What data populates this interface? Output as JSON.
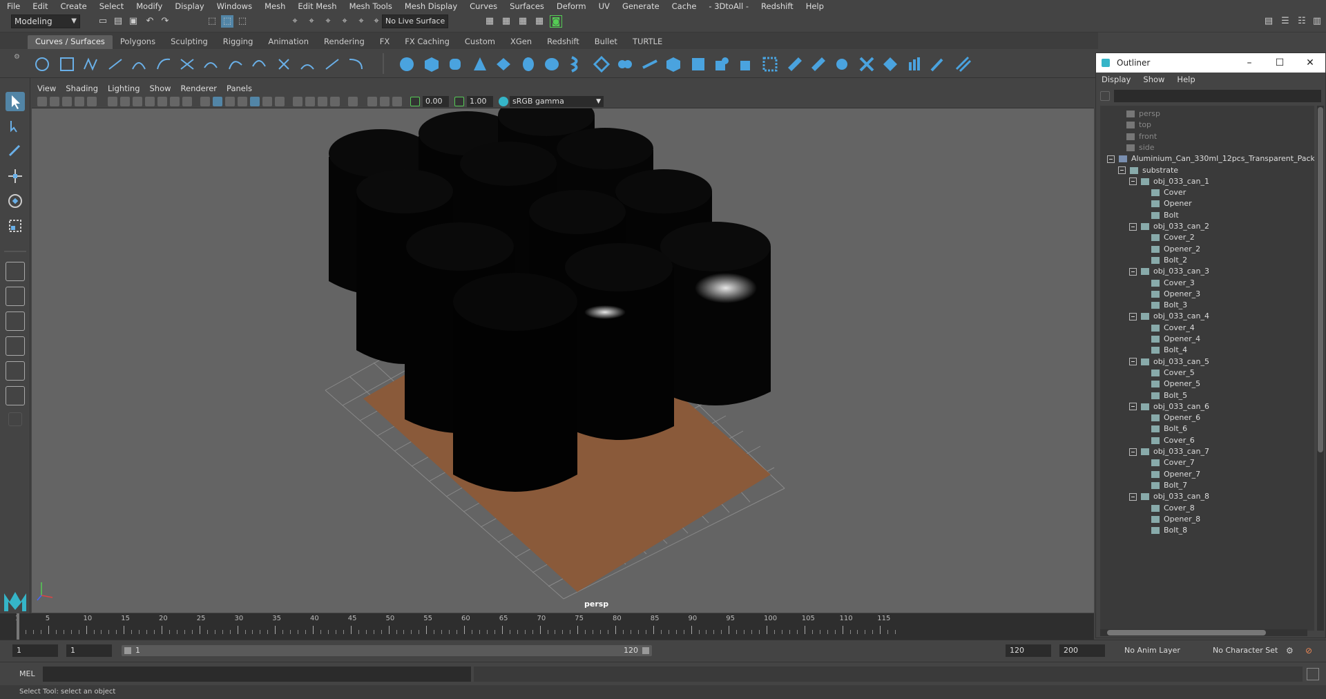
{
  "menubar": [
    "File",
    "Edit",
    "Create",
    "Select",
    "Modify",
    "Display",
    "Windows",
    "Mesh",
    "Edit Mesh",
    "Mesh Tools",
    "Mesh Display",
    "Curves",
    "Surfaces",
    "Deform",
    "UV",
    "Generate",
    "Cache",
    "- 3DtoAll -",
    "Redshift",
    "Help"
  ],
  "statusline": {
    "mode": "Modeling",
    "live_surface": "No Live Surface"
  },
  "shelf_tabs": [
    "Curves / Surfaces",
    "Polygons",
    "Sculpting",
    "Rigging",
    "Animation",
    "Rendering",
    "FX",
    "FX Caching",
    "Custom",
    "XGen",
    "Redshift",
    "Bullet",
    "TURTLE"
  ],
  "shelf_active": "Curves / Surfaces",
  "panel_menu": [
    "View",
    "Shading",
    "Lighting",
    "Show",
    "Renderer",
    "Panels"
  ],
  "panel_toolbar": {
    "exposure": "0.00",
    "gamma": "1.00",
    "colorspace": "sRGB gamma"
  },
  "viewport": {
    "camera": "persp"
  },
  "outliner": {
    "title": "Outliner",
    "menu": [
      "Display",
      "Show",
      "Help"
    ],
    "cameras": [
      "persp",
      "top",
      "front",
      "side"
    ],
    "root": "Aluminium_Can_330ml_12pcs_Transparent_Pack",
    "group": "substrate",
    "cans": [
      {
        "name": "obj_033_can_1",
        "children": [
          "Cover",
          "Opener",
          "Bolt"
        ]
      },
      {
        "name": "obj_033_can_2",
        "children": [
          "Cover_2",
          "Opener_2",
          "Bolt_2"
        ]
      },
      {
        "name": "obj_033_can_3",
        "children": [
          "Cover_3",
          "Opener_3",
          "Bolt_3"
        ]
      },
      {
        "name": "obj_033_can_4",
        "children": [
          "Cover_4",
          "Opener_4",
          "Bolt_4"
        ]
      },
      {
        "name": "obj_033_can_5",
        "children": [
          "Cover_5",
          "Opener_5",
          "Bolt_5"
        ]
      },
      {
        "name": "obj_033_can_6",
        "children": [
          "Opener_6",
          "Bolt_6",
          "Cover_6"
        ]
      },
      {
        "name": "obj_033_can_7",
        "children": [
          "Cover_7",
          "Opener_7",
          "Bolt_7"
        ]
      },
      {
        "name": "obj_033_can_8",
        "children": [
          "Cover_8",
          "Opener_8",
          "Bolt_8"
        ]
      }
    ]
  },
  "timeline": {
    "labels": [
      "1",
      "5",
      "10",
      "15",
      "20",
      "25",
      "30",
      "35",
      "40",
      "45",
      "50",
      "55",
      "60",
      "65",
      "70",
      "75",
      "80",
      "85",
      "90",
      "95",
      "100",
      "105",
      "110",
      "115"
    ],
    "current_frame": "1"
  },
  "range": {
    "start": "1",
    "playback_start": "1",
    "slider_start": "1",
    "slider_end": "120",
    "playback_end": "120",
    "end": "200",
    "anim_layer": "No Anim Layer",
    "char_set": "No Character Set"
  },
  "cmdline": {
    "lang": "MEL"
  },
  "helpline": "Select Tool: select an object",
  "colors": {
    "accent": "#5285a6",
    "viewport_bg": "#646464"
  }
}
